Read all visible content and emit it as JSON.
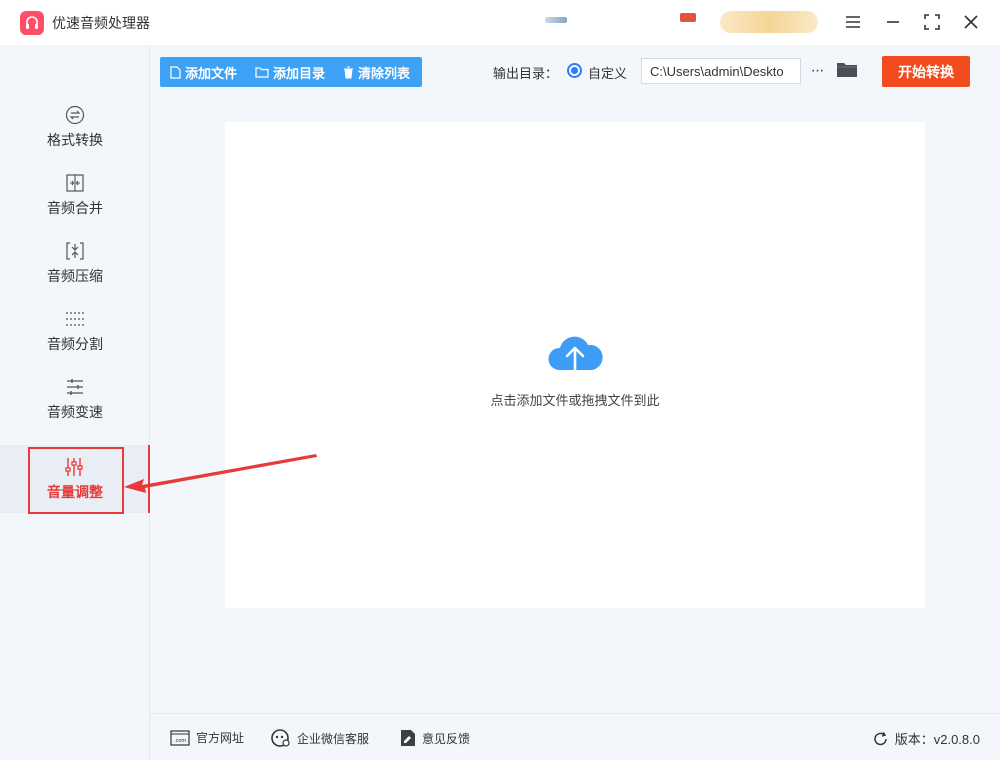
{
  "app": {
    "title": "优速音频处理器"
  },
  "colors": {
    "accent": "#3da2f5",
    "start": "#f24c1e",
    "active": "#e83a3a",
    "radio": "#2f7ef6"
  },
  "sidebar": {
    "items": [
      {
        "label": "格式转换",
        "icon": "format-convert-icon"
      },
      {
        "label": "音频合并",
        "icon": "audio-merge-icon"
      },
      {
        "label": "音频压缩",
        "icon": "audio-compress-icon"
      },
      {
        "label": "音频分割",
        "icon": "audio-split-icon"
      },
      {
        "label": "音频变速",
        "icon": "audio-speed-icon"
      },
      {
        "label": "音量调整",
        "icon": "volume-adjust-icon",
        "active": true
      }
    ]
  },
  "toolbar": {
    "add_file": "添加文件",
    "add_dir": "添加目录",
    "clear_list": "清除列表",
    "output_label": "输出目录：",
    "radio_label": "自定义",
    "output_path": "C:\\Users\\admin\\Deskto",
    "more": "···",
    "start": "开始转换"
  },
  "main": {
    "drop_hint": "点击添加文件或拖拽文件到此"
  },
  "footer": {
    "website": "官方网址",
    "wechat": "企业微信客服",
    "feedback": "意见反馈",
    "version": "版本：v2.0.8.0"
  }
}
